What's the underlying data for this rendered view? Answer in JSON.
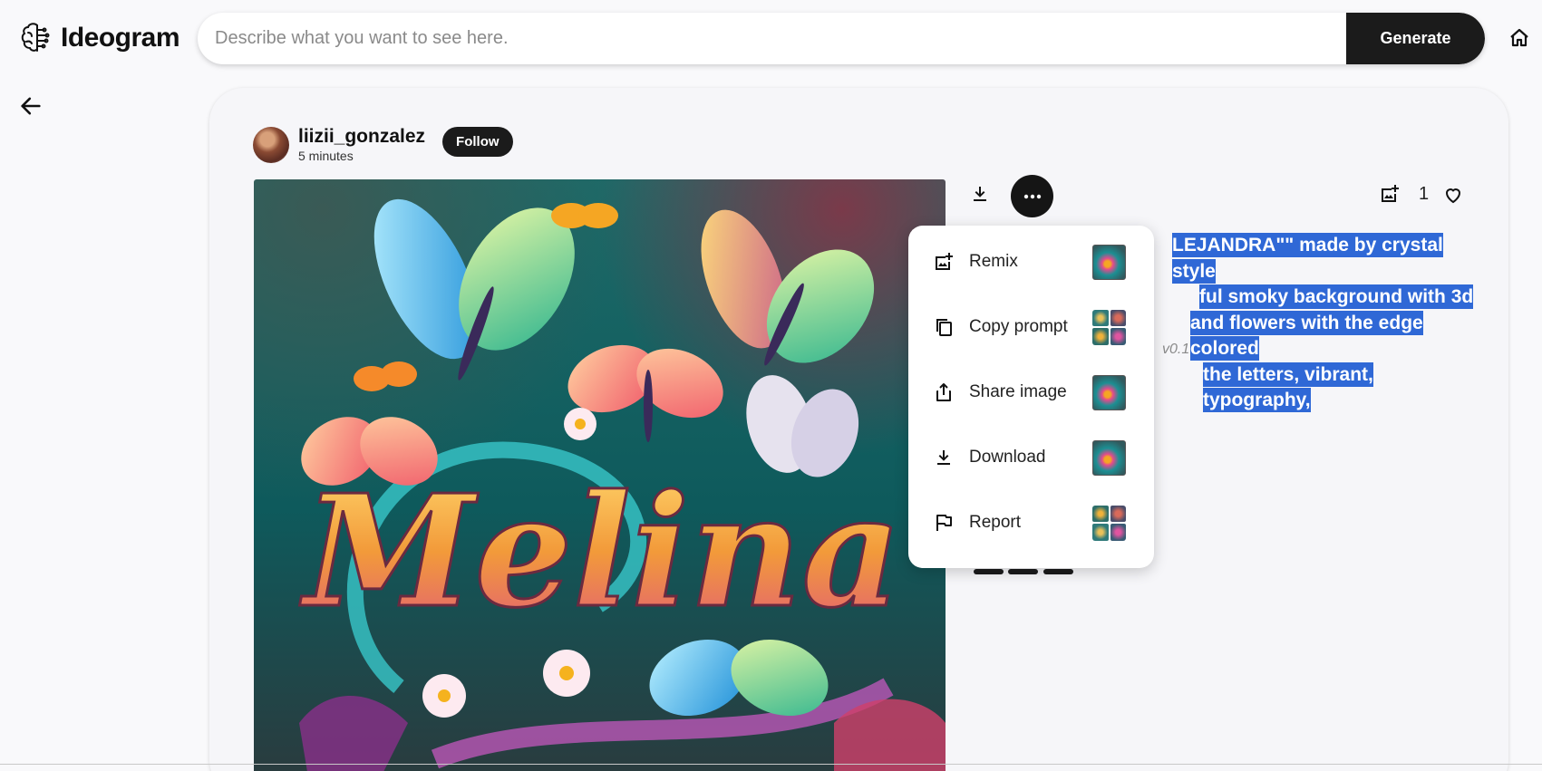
{
  "app": {
    "name": "Ideogram"
  },
  "search": {
    "placeholder": "Describe what you want to see here.",
    "button_label": "Generate"
  },
  "post": {
    "username": "liizii_gonzalez",
    "timestamp": "5 minutes",
    "follow_label": "Follow",
    "like_count": "1",
    "prompt_lines": [
      "LEJANDRA\"\" made by crystal style",
      "ful smoky background with 3d",
      "and flowers with the edge colored",
      "the letters, vibrant, typography,"
    ],
    "version": "v0.1",
    "image_text": "Melina"
  },
  "menu": {
    "items": [
      {
        "label": "Remix",
        "icon": "remix-icon",
        "thumb": "single"
      },
      {
        "label": "Copy prompt",
        "icon": "copy-icon",
        "thumb": "grid"
      },
      {
        "label": "Share image",
        "icon": "share-icon",
        "thumb": "single"
      },
      {
        "label": "Download",
        "icon": "download-icon",
        "thumb": "single"
      },
      {
        "label": "Report",
        "icon": "flag-icon",
        "thumb": "grid"
      }
    ]
  },
  "colors": {
    "accent": "#1b1b1b",
    "selection": "#2f68d6",
    "background": "#f9f9fb"
  }
}
